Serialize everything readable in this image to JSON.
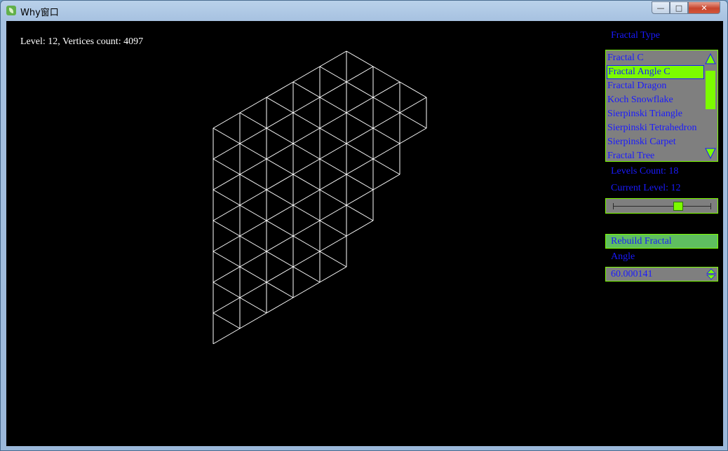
{
  "window": {
    "title": "Why窗口",
    "buttons": {
      "minimize": "—",
      "maximize": "□",
      "close": "✕"
    }
  },
  "status_text": "Level: 12, Vertices count: 4097",
  "panel": {
    "fractal_type_label": "Fractal Type",
    "fractal_types": [
      "Fractal C",
      "Fractal Angle C",
      "Fractal Dragon",
      "Koch Snowflake",
      "Sierpinski Triangle",
      "Sierpinski Tetrahedron",
      "Sierpinski Carpet",
      "Fractal Tree"
    ],
    "selected_type": "Fractal Angle C",
    "levels_count_label": "Levels Count: 18",
    "current_level_label": "Current Level: 12",
    "level_slider": {
      "value": 12,
      "max": 18
    },
    "rebuild_button": "Rebuild Fractal",
    "angle_label": "Angle",
    "angle_value": "60.000141"
  },
  "colors": {
    "accent": "#7cfc00",
    "text": "#1a1aff",
    "canvas": "#000000",
    "lines": "#ffffff"
  }
}
